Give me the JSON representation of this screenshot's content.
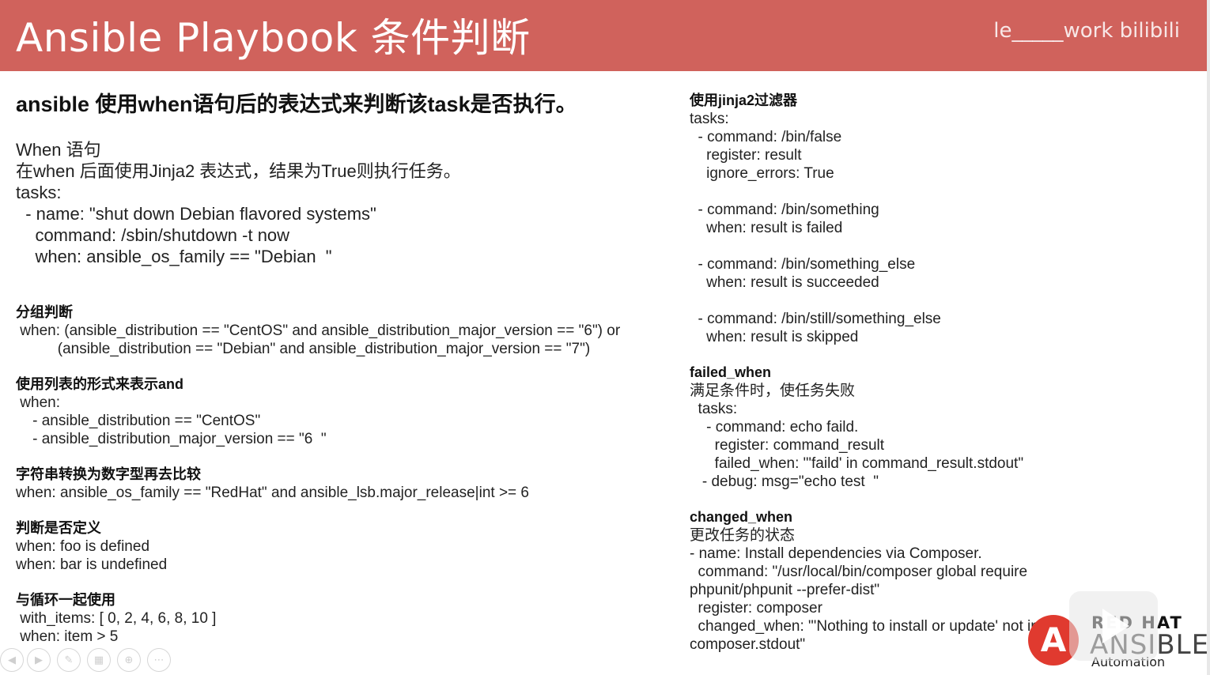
{
  "header": {
    "title": "Ansible Playbook 条件判断",
    "watermark": "le_____work bilibili"
  },
  "left": {
    "main_title": "ansible 使用when语句后的表达式来判断该task是否执行。",
    "intro": [
      "When 语句",
      "在when 后面使用Jinja2 表达式，结果为True则执行任务。",
      "tasks:",
      "  - name: \"shut down Debian flavored systems\"",
      "    command: /sbin/shutdown -t now",
      "    when: ansible_os_family == \"Debian  \""
    ],
    "group": {
      "heading": "分组判断",
      "lines": [
        " when: (ansible_distribution == \"CentOS\" and ansible_distribution_major_version == \"6\") or",
        "          (ansible_distribution == \"Debian\" and ansible_distribution_major_version == \"7\")"
      ]
    },
    "list_and": {
      "heading": "使用列表的形式来表示and",
      "lines": [
        " when:",
        "    - ansible_distribution == \"CentOS\"",
        "    - ansible_distribution_major_version == \"6  \""
      ]
    },
    "str_to_int": {
      "heading": "字符串转换为数字型再去比较",
      "lines": [
        "when: ansible_os_family == \"RedHat\" and ansible_lsb.major_release|int >= 6"
      ]
    },
    "defined": {
      "heading": "判断是否定义",
      "lines": [
        "when: foo is defined",
        "when: bar is undefined"
      ]
    },
    "loop": {
      "heading": "与循环一起使用",
      "lines": [
        " with_items: [ 0, 2, 4, 6, 8, 10 ]",
        " when: item > 5"
      ]
    }
  },
  "right": {
    "jinja_filter": {
      "heading": "使用jinja2过滤器",
      "lines": [
        "tasks:",
        "  - command: /bin/false",
        "    register: result",
        "    ignore_errors: True",
        "",
        "  - command: /bin/something",
        "    when: result is failed",
        "",
        "  - command: /bin/something_else",
        "    when: result is succeeded",
        "",
        "  - command: /bin/still/something_else",
        "    when: result is skipped"
      ]
    },
    "failed_when": {
      "heading": "failed_when",
      "lines": [
        "满足条件时，使任务失败",
        "  tasks:",
        "    - command: echo faild.",
        "      register: command_result",
        "      failed_when: \"'faild' in command_result.stdout\"",
        "   - debug: msg=\"echo test  \""
      ]
    },
    "changed_when": {
      "heading": "changed_when",
      "lines": [
        "更改任务的状态",
        "- name: Install dependencies via Composer.",
        "  command: \"/usr/local/bin/composer global require",
        "phpunit/phpunit --prefer-dist\"",
        "  register: composer",
        "  changed_when: \"'Nothing to install or update' not in",
        "composer.stdout\""
      ]
    }
  },
  "logo": {
    "mark": "A",
    "line1": "RED HAT",
    "line2": "ANSIBLE",
    "line3": "Automation"
  },
  "icons": [
    "prev-icon",
    "play-icon",
    "pen-icon",
    "grid-icon",
    "zoom-icon",
    "more-icon"
  ]
}
